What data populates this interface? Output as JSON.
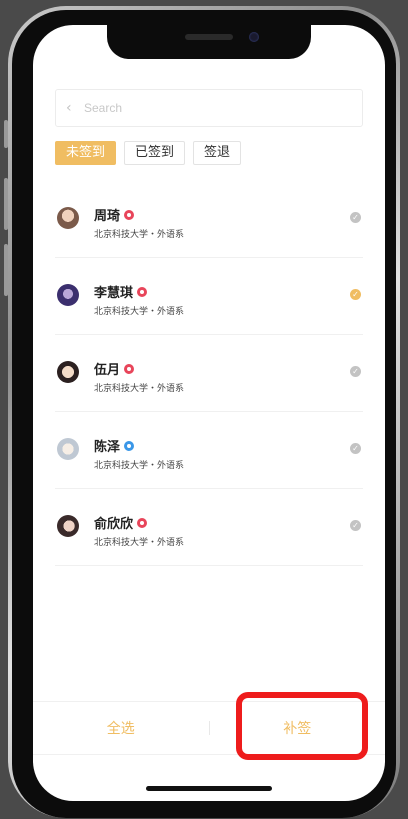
{
  "search": {
    "placeholder": "Search"
  },
  "tabs": [
    {
      "label": "未签到",
      "active": true
    },
    {
      "label": "已签到",
      "active": false
    },
    {
      "label": "签退",
      "active": false
    }
  ],
  "students": [
    {
      "name": "周琦",
      "gender": "female",
      "school": "北京科技大学・外语系",
      "checked": false
    },
    {
      "name": "李慧琪",
      "gender": "female",
      "school": "北京科技大学・外语系",
      "checked": true
    },
    {
      "name": "伍月",
      "gender": "female",
      "school": "北京科技大学・外语系",
      "checked": false
    },
    {
      "name": "陈泽",
      "gender": "male",
      "school": "北京科技大学・外语系",
      "checked": false
    },
    {
      "name": "俞欣欣",
      "gender": "female",
      "school": "北京科技大学・外语系",
      "checked": false
    }
  ],
  "footer": {
    "select_all": "全选",
    "makeup_sign": "补签"
  },
  "colors": {
    "accent": "#f0bd62",
    "female": "#e8455a",
    "male": "#3a97e8",
    "highlight": "#ee1c1c"
  }
}
